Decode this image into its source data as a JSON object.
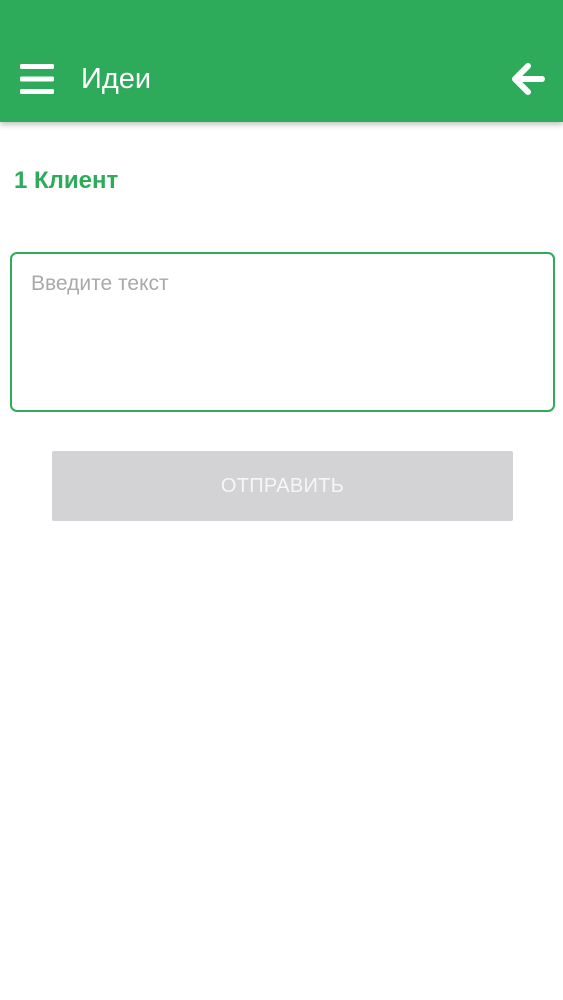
{
  "appbar": {
    "title": "Идеи",
    "menu_icon": "hamburger-menu-icon",
    "back_icon": "arrow-left-icon",
    "color": "#2eab5a"
  },
  "section": {
    "title": "1 Клиент"
  },
  "form": {
    "text_value": "",
    "text_placeholder": "Введите текст",
    "submit_label": "ОТПРАВИТЬ",
    "submit_state": "disabled",
    "submit_color": "#d3d2d5"
  }
}
